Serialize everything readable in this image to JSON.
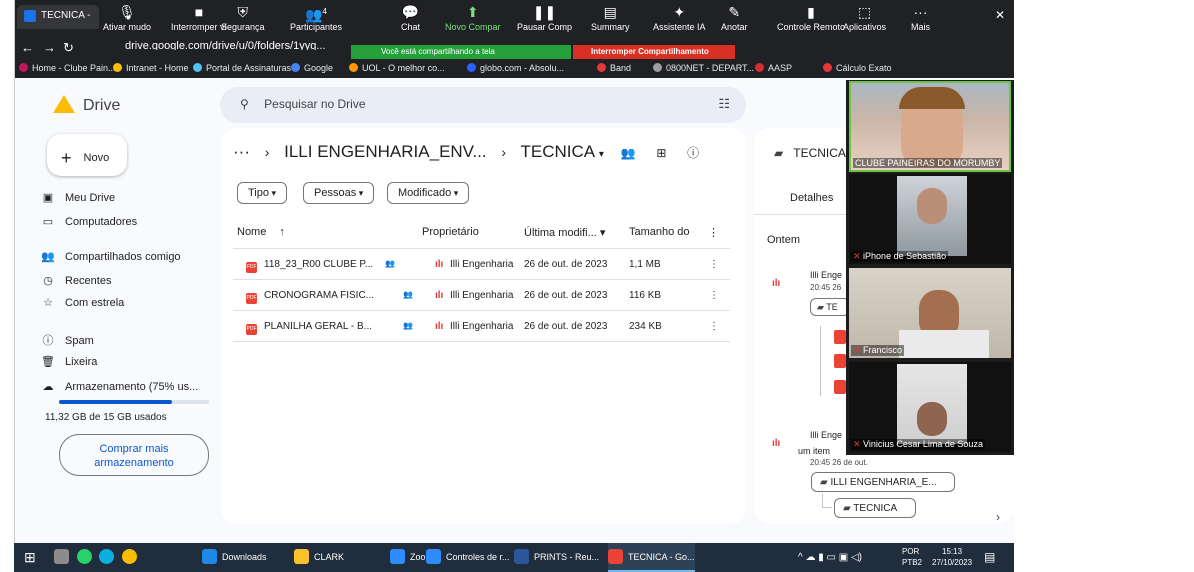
{
  "browser": {
    "tab_title": "TECNICA -",
    "url": "drive.google.com/drive/u/0/folders/1yyg...",
    "share_banner": "Você está compartilhando a tela",
    "stop_share": "Interromper Compartilhamento",
    "close_glyph": "✕"
  },
  "zoom_toolbar": [
    {
      "label": "Ativar mudo",
      "icon": "mic-icon",
      "glyph": "🎙"
    },
    {
      "label": "Interromper ví",
      "icon": "video-icon",
      "glyph": "■"
    },
    {
      "label": "Segurança",
      "icon": "shield-icon",
      "glyph": "⛨"
    },
    {
      "label": "Participantes",
      "icon": "participants-icon",
      "glyph": "👥",
      "badge": "4"
    },
    {
      "label": "Chat",
      "icon": "chat-icon",
      "glyph": "💬"
    },
    {
      "label": "Novo Compar",
      "icon": "share-icon",
      "glyph": "⬆"
    },
    {
      "label": "Pausar Comp",
      "icon": "pause-icon",
      "glyph": "❚❚"
    },
    {
      "label": "Summary",
      "icon": "summary-icon",
      "glyph": "▤"
    },
    {
      "label": "Assistente IA",
      "icon": "sparkle-icon",
      "glyph": "✦"
    },
    {
      "label": "Anotar",
      "icon": "pen-icon",
      "glyph": "✎"
    },
    {
      "label": "Controle Remoto",
      "icon": "remote-icon",
      "glyph": "▮"
    },
    {
      "label": "Aplicativos",
      "icon": "apps-icon",
      "glyph": "⬚"
    },
    {
      "label": "Mais",
      "icon": "more-icon",
      "glyph": "···"
    }
  ],
  "bookmarks": [
    {
      "label": "Home - Clube Pain...",
      "color": "#c2185b"
    },
    {
      "label": "Intranet - Home",
      "color": "#fbbc04"
    },
    {
      "label": "Portal de Assinaturas",
      "color": "#4fc3f7"
    },
    {
      "label": "Google",
      "color": "#4285f4"
    },
    {
      "label": "UOL - O melhor co...",
      "color": "#ff9800"
    },
    {
      "label": "globo.com - Absolu...",
      "color": "#2962ff"
    },
    {
      "label": "Band",
      "color": "#e53935"
    },
    {
      "label": "0800NET - DEPART...",
      "color": "#9e9e9e"
    },
    {
      "label": "AASP",
      "color": "#d32f2f"
    },
    {
      "label": "Cálculo Exato",
      "color": "#e53935"
    }
  ],
  "drive": {
    "logo": "Drive",
    "search_placeholder": "Pesquisar no Drive",
    "new_button": "Novo",
    "sidebar": [
      {
        "label": "Meu Drive",
        "glyph": "▣"
      },
      {
        "label": "Computadores",
        "glyph": "▭"
      },
      {
        "label": "Compartilhados comigo",
        "glyph": "👥"
      },
      {
        "label": "Recentes",
        "glyph": "◷"
      },
      {
        "label": "Com estrela",
        "glyph": "☆"
      },
      {
        "label": "Spam",
        "glyph": "ⓘ"
      },
      {
        "label": "Lixeira",
        "glyph": "🗑"
      },
      {
        "label": "Armazenamento (75% us...",
        "glyph": "☁"
      }
    ],
    "storage_fraction": 0.75,
    "storage_text": "11,32 GB de 15 GB usados",
    "buy_button": "Comprar mais armazenamento",
    "breadcrumb": {
      "dots": "···",
      "parent": "ILLI ENGENHARIA_ENV...",
      "current": "TECNICA"
    },
    "filters": [
      "Tipo",
      "Pessoas",
      "Modificado"
    ],
    "columns": {
      "name": "Nome",
      "owner": "Proprietário",
      "modified": "Última modifi...",
      "size": "Tamanho do"
    },
    "files": [
      {
        "name": "118_23_R00 CLUBE P...",
        "owner": "Illi Engenharia",
        "modified": "26 de out. de 2023",
        "size": "1,1 MB"
      },
      {
        "name": "CRONOGRAMA FISIC...",
        "owner": "Illi Engenharia",
        "modified": "26 de out. de 2023",
        "size": "116 KB"
      },
      {
        "name": "PLANILHA GERAL - B...",
        "owner": "Illi Engenharia",
        "modified": "26 de out. de 2023",
        "size": "234 KB"
      }
    ],
    "details": {
      "title": "TECNICA",
      "tab": "Detalhes",
      "section": "Ontem",
      "activity1_user": "Illi Enge",
      "activity1_time": "20:45 26",
      "activity1_folder": "TE",
      "activity2_user": "Illi Enge",
      "activity2_text": "um item",
      "activity2_time": "20:45 26 de out.",
      "folder1": "ILLI ENGENHARIA_E...",
      "folder2": "TECNICA"
    }
  },
  "participants": [
    {
      "name": "CLUBE PAINEIRAS DO MORUMBY"
    },
    {
      "name": "iPhone de Sebastião"
    },
    {
      "name": "Francisco"
    },
    {
      "name": "Vinicius Cesar Lima de Souza"
    }
  ],
  "taskbar": {
    "items": [
      {
        "label": "Downloads",
        "color": "#1e88e5"
      },
      {
        "label": "CLARK",
        "color": "#fbc02d"
      },
      {
        "label": "Zoom",
        "color": "#2d8cff"
      },
      {
        "label": "Controles de r...",
        "color": "#2d8cff"
      },
      {
        "label": "PRINTS - Reu...",
        "color": "#2b579a"
      },
      {
        "label": "TECNICA - Go...",
        "color": "#ea4335"
      }
    ],
    "lang": "POR",
    "lang2": "PTB2",
    "time": "15:13",
    "date": "27/10/2023"
  }
}
